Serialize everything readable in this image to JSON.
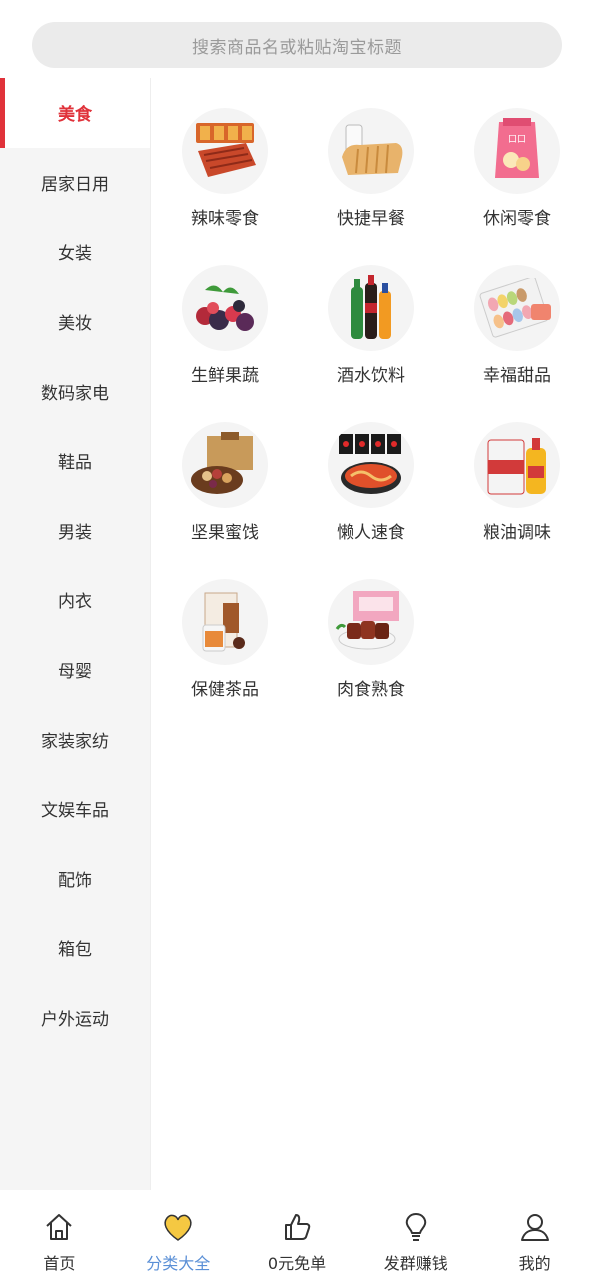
{
  "search": {
    "placeholder": "搜索商品名或粘贴淘宝标题"
  },
  "sidebar": {
    "items": [
      {
        "label": "美食"
      },
      {
        "label": "居家日用"
      },
      {
        "label": "女装"
      },
      {
        "label": "美妆"
      },
      {
        "label": "数码家电"
      },
      {
        "label": "鞋品"
      },
      {
        "label": "男装"
      },
      {
        "label": "内衣"
      },
      {
        "label": "母婴"
      },
      {
        "label": "家装家纺"
      },
      {
        "label": "文娱车品"
      },
      {
        "label": "配饰"
      },
      {
        "label": "箱包"
      },
      {
        "label": "户外运动"
      }
    ],
    "active_index": 0
  },
  "categories": [
    {
      "label": "辣味零食"
    },
    {
      "label": "快捷早餐"
    },
    {
      "label": "休闲零食"
    },
    {
      "label": "生鲜果蔬"
    },
    {
      "label": "酒水饮料"
    },
    {
      "label": "幸福甜品"
    },
    {
      "label": "坚果蜜饯"
    },
    {
      "label": "懒人速食"
    },
    {
      "label": "粮油调味"
    },
    {
      "label": "保健茶品"
    },
    {
      "label": "肉食熟食"
    }
  ],
  "tabbar": {
    "items": [
      {
        "label": "首页",
        "icon": "home-icon"
      },
      {
        "label": "分类大全",
        "icon": "heart-icon"
      },
      {
        "label": "0元免单",
        "icon": "thumbs-up-icon"
      },
      {
        "label": "发群赚钱",
        "icon": "lightbulb-icon"
      },
      {
        "label": "我的",
        "icon": "user-icon"
      }
    ],
    "active_index": 1
  },
  "colors": {
    "accent": "#e0323a",
    "tab_active": "#5a8fd6",
    "heart": "#f5c842"
  }
}
